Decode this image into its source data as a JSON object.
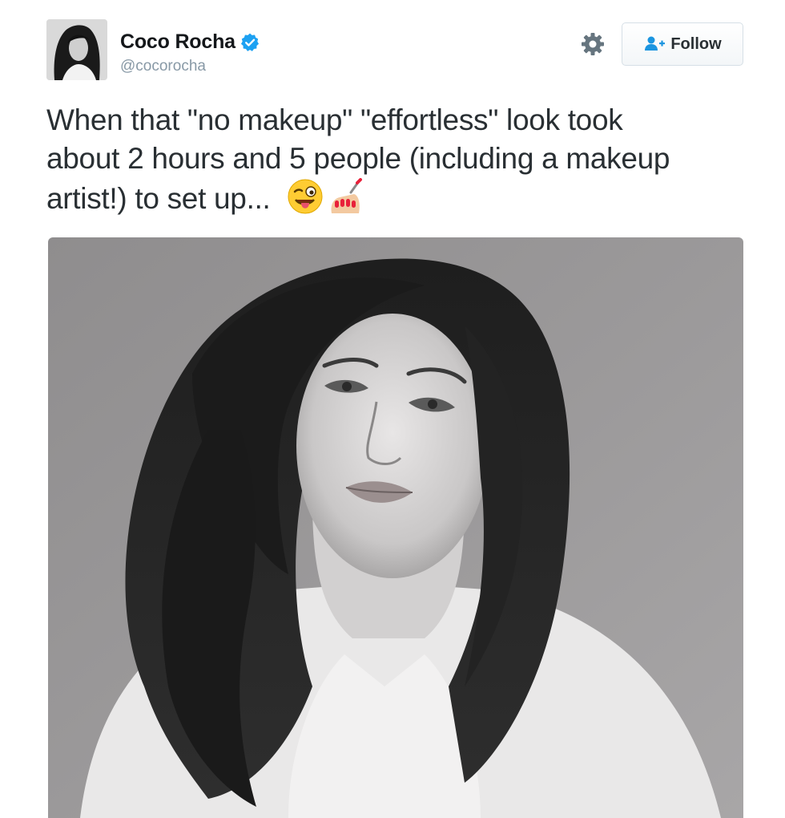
{
  "author": {
    "display_name": "Coco Rocha",
    "handle": "@cocorocha",
    "verified": true,
    "avatar_icon": "profile-photo"
  },
  "actions": {
    "follow_label": "Follow",
    "follow_icon": "add-user-icon",
    "settings_icon": "gear-icon"
  },
  "tweet": {
    "lines": [
      "When that \"no makeup\" \"effortless\" look took",
      "about 2 hours and 5 people (including a makeup",
      "artist!) to set up..."
    ],
    "emojis": [
      "winking-face-with-tongue-icon",
      "nail-polish-icon"
    ]
  },
  "media": {
    "type": "photo",
    "style": "black-and-white portrait"
  },
  "colors": {
    "verified_blue": "#1da1f2",
    "handle_gray": "#8899a6",
    "text": "#292f33",
    "follow_icon_blue": "#1b95e0"
  }
}
